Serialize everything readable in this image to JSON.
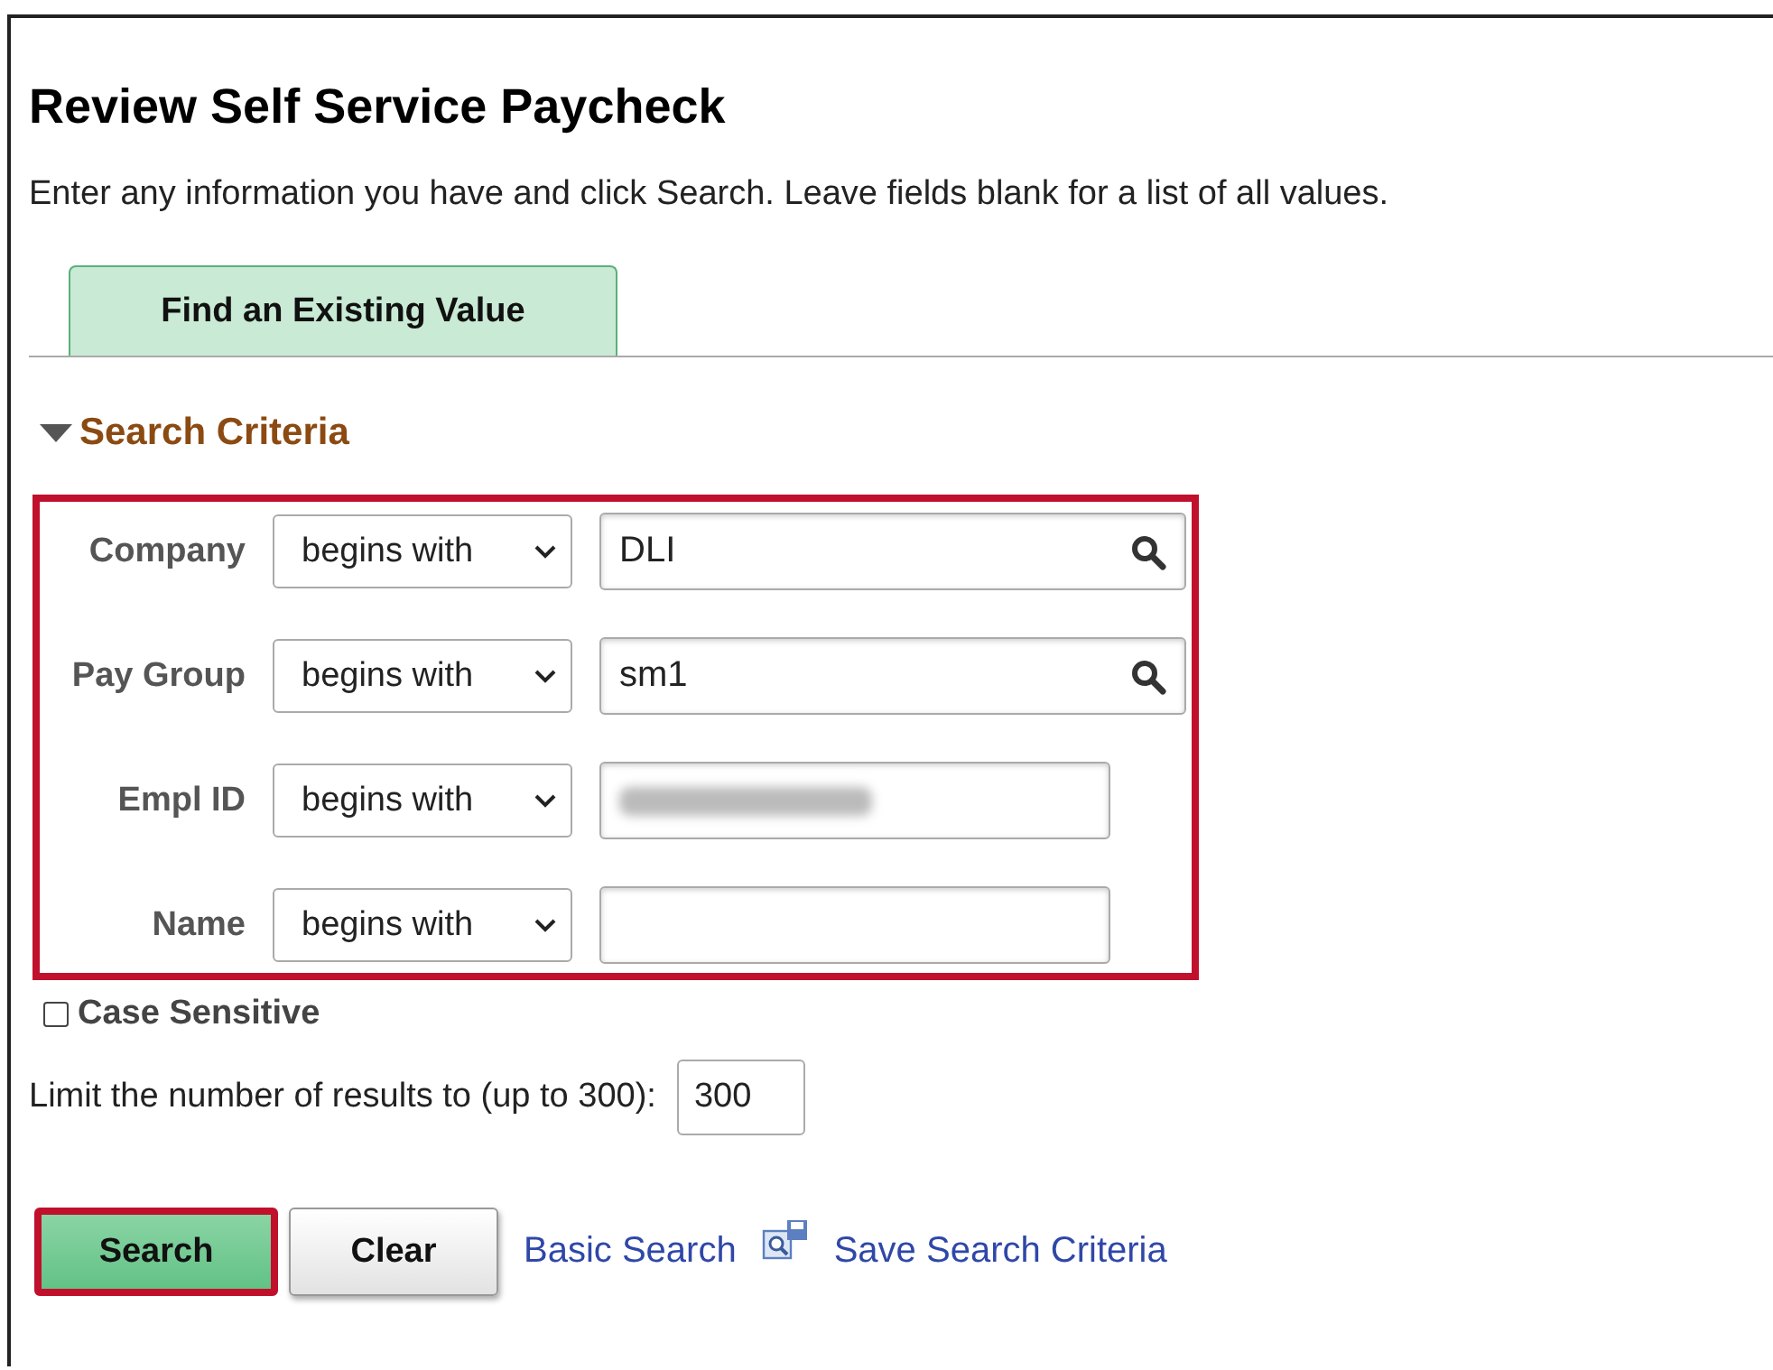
{
  "title": "Review Self Service Paycheck",
  "instructions": "Enter any information you have and click Search. Leave fields blank for a list of all values.",
  "tabs": [
    {
      "label": "Find an Existing Value",
      "selected": true
    }
  ],
  "section": {
    "label": "Search Criteria",
    "expanded": true
  },
  "criteria_highlighted": true,
  "criteria": [
    {
      "label": "Company",
      "operator": "begins with",
      "value": "DLI",
      "lookup": true,
      "redacted": false
    },
    {
      "label": "Pay Group",
      "operator": "begins with",
      "value": "sm1",
      "lookup": true,
      "redacted": false
    },
    {
      "label": "Empl ID",
      "operator": "begins with",
      "lookup": false,
      "redacted": true
    },
    {
      "label": "Name",
      "operator": "begins with",
      "lookup": false,
      "redacted": false
    }
  ],
  "case_sensitive": {
    "label": "Case Sensitive",
    "checked": false
  },
  "limit": {
    "label": "Limit the number of results to (up to 300):",
    "value": "300"
  },
  "buttons": [
    {
      "label": "Search",
      "kind": "primary",
      "highlighted": true
    },
    {
      "label": "Clear",
      "kind": "secondary",
      "highlighted": false
    }
  ],
  "links": [
    {
      "label": "Basic Search",
      "icon": false
    },
    {
      "label": "Save Search Criteria",
      "icon": true
    }
  ]
}
